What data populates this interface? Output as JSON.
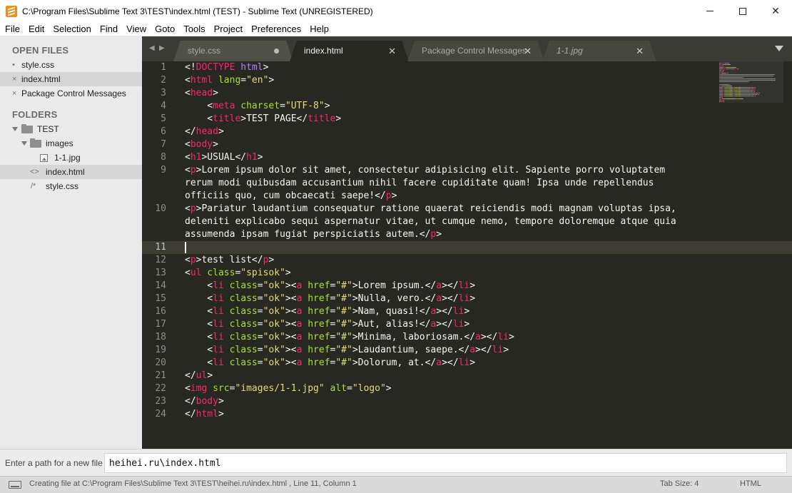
{
  "window": {
    "title": "C:\\Program Files\\Sublime Text 3\\TEST\\index.html (TEST) - Sublime Text (UNREGISTERED)"
  },
  "menu": [
    "File",
    "Edit",
    "Selection",
    "Find",
    "View",
    "Goto",
    "Tools",
    "Project",
    "Preferences",
    "Help"
  ],
  "sidebar": {
    "open_files_heading": "OPEN FILES",
    "open_files": [
      {
        "label": "style.css",
        "mark": "•"
      },
      {
        "label": "index.html",
        "mark": "×"
      },
      {
        "label": "Package Control Messages",
        "mark": "×"
      }
    ],
    "folders_heading": "FOLDERS",
    "tree": [
      {
        "label": "TEST",
        "icon": "folder-open-icon"
      },
      {
        "label": "images",
        "icon": "folder-open-icon"
      },
      {
        "label": "1-1.jpg",
        "icon": "image-file-icon"
      },
      {
        "label": "index.html",
        "icon": "html-file-icon",
        "mark": "<>"
      },
      {
        "label": "style.css",
        "icon": "css-file-icon",
        "mark": "/*"
      }
    ]
  },
  "tabs": [
    {
      "label": "style.css",
      "state": "modified"
    },
    {
      "label": "index.html",
      "state": "active"
    },
    {
      "label": "Package Control Messages",
      "state": "closable"
    },
    {
      "label": "1-1.jpg",
      "state": "preview"
    }
  ],
  "editor": {
    "current_line": 11,
    "lines": [
      {
        "n": "1",
        "segs": [
          [
            "p",
            "<!"
          ],
          [
            "t",
            "DOCTYPE"
          ],
          [
            "p",
            " "
          ],
          [
            "k",
            "html"
          ],
          [
            "p",
            ">"
          ]
        ]
      },
      {
        "n": "2",
        "segs": [
          [
            "p",
            "<"
          ],
          [
            "t",
            "html"
          ],
          [
            "p",
            " "
          ],
          [
            "a",
            "lang"
          ],
          [
            "p",
            "="
          ],
          [
            "s",
            "\"en\""
          ],
          [
            "p",
            ">"
          ]
        ]
      },
      {
        "n": "3",
        "segs": [
          [
            "p",
            "<"
          ],
          [
            "t",
            "head"
          ],
          [
            "p",
            ">"
          ]
        ]
      },
      {
        "n": "4",
        "segs": [
          [
            "p",
            "    <"
          ],
          [
            "t",
            "meta"
          ],
          [
            "p",
            " "
          ],
          [
            "a",
            "charset"
          ],
          [
            "p",
            "="
          ],
          [
            "s",
            "\"UTF-8\""
          ],
          [
            "p",
            ">"
          ]
        ]
      },
      {
        "n": "5",
        "segs": [
          [
            "p",
            "    <"
          ],
          [
            "t",
            "title"
          ],
          [
            "p",
            ">TEST PAGE</"
          ],
          [
            "t",
            "title"
          ],
          [
            "p",
            ">"
          ]
        ]
      },
      {
        "n": "6",
        "segs": [
          [
            "p",
            "</"
          ],
          [
            "t",
            "head"
          ],
          [
            "p",
            ">"
          ]
        ]
      },
      {
        "n": "7",
        "segs": [
          [
            "p",
            "<"
          ],
          [
            "t",
            "body"
          ],
          [
            "p",
            ">"
          ]
        ]
      },
      {
        "n": "8",
        "segs": [
          [
            "p",
            "<"
          ],
          [
            "t",
            "h1"
          ],
          [
            "p",
            ">USUAL</"
          ],
          [
            "t",
            "h1"
          ],
          [
            "p",
            ">"
          ]
        ]
      },
      {
        "n": "9",
        "segs": [
          [
            "p",
            "<"
          ],
          [
            "t",
            "p"
          ],
          [
            "p",
            ">Lorem ipsum dolor sit amet, consectetur adipisicing elit. Sapiente porro voluptatem"
          ]
        ]
      },
      {
        "n": "",
        "segs": [
          [
            "p",
            "rerum modi quibusdam accusantium nihil facere cupiditate quam! Ipsa unde repellendus"
          ]
        ]
      },
      {
        "n": "",
        "segs": [
          [
            "p",
            "officiis quo, cum obcaecati saepe!</"
          ],
          [
            "t",
            "p"
          ],
          [
            "p",
            ">"
          ]
        ]
      },
      {
        "n": "10",
        "segs": [
          [
            "p",
            "<"
          ],
          [
            "t",
            "p"
          ],
          [
            "p",
            ">Pariatur laudantium consequatur ratione quaerat reiciendis modi magnam voluptas ipsa,"
          ]
        ]
      },
      {
        "n": "",
        "segs": [
          [
            "p",
            "deleniti explicabo sequi aspernatur vitae, ut cumque nemo, tempore doloremque atque quia"
          ]
        ]
      },
      {
        "n": "",
        "segs": [
          [
            "p",
            "assumenda ipsam fugiat perspiciatis autem.</"
          ],
          [
            "t",
            "p"
          ],
          [
            "p",
            ">"
          ]
        ]
      },
      {
        "n": "11",
        "segs": []
      },
      {
        "n": "12",
        "segs": [
          [
            "p",
            "<"
          ],
          [
            "t",
            "p"
          ],
          [
            "p",
            ">test list</"
          ],
          [
            "t",
            "p"
          ],
          [
            "p",
            ">"
          ]
        ]
      },
      {
        "n": "13",
        "segs": [
          [
            "p",
            "<"
          ],
          [
            "t",
            "ul"
          ],
          [
            "p",
            " "
          ],
          [
            "a",
            "class"
          ],
          [
            "p",
            "="
          ],
          [
            "s",
            "\"spisok\""
          ],
          [
            "p",
            ">"
          ]
        ]
      },
      {
        "n": "14",
        "segs": [
          [
            "p",
            "    <"
          ],
          [
            "t",
            "li"
          ],
          [
            "p",
            " "
          ],
          [
            "a",
            "class"
          ],
          [
            "p",
            "="
          ],
          [
            "s",
            "\"ok\""
          ],
          [
            "p",
            "><"
          ],
          [
            "t",
            "a"
          ],
          [
            "p",
            " "
          ],
          [
            "a",
            "href"
          ],
          [
            "p",
            "="
          ],
          [
            "s",
            "\"#\""
          ],
          [
            "p",
            ">Lorem ipsum.</"
          ],
          [
            "t",
            "a"
          ],
          [
            "p",
            "></"
          ],
          [
            "t",
            "li"
          ],
          [
            "p",
            ">"
          ]
        ]
      },
      {
        "n": "15",
        "segs": [
          [
            "p",
            "    <"
          ],
          [
            "t",
            "li"
          ],
          [
            "p",
            " "
          ],
          [
            "a",
            "class"
          ],
          [
            "p",
            "="
          ],
          [
            "s",
            "\"ok\""
          ],
          [
            "p",
            "><"
          ],
          [
            "t",
            "a"
          ],
          [
            "p",
            " "
          ],
          [
            "a",
            "href"
          ],
          [
            "p",
            "="
          ],
          [
            "s",
            "\"#\""
          ],
          [
            "p",
            ">Nulla, vero.</"
          ],
          [
            "t",
            "a"
          ],
          [
            "p",
            "></"
          ],
          [
            "t",
            "li"
          ],
          [
            "p",
            ">"
          ]
        ]
      },
      {
        "n": "16",
        "segs": [
          [
            "p",
            "    <"
          ],
          [
            "t",
            "li"
          ],
          [
            "p",
            " "
          ],
          [
            "a",
            "class"
          ],
          [
            "p",
            "="
          ],
          [
            "s",
            "\"ok\""
          ],
          [
            "p",
            "><"
          ],
          [
            "t",
            "a"
          ],
          [
            "p",
            " "
          ],
          [
            "a",
            "href"
          ],
          [
            "p",
            "="
          ],
          [
            "s",
            "\"#\""
          ],
          [
            "p",
            ">Nam, quasi!</"
          ],
          [
            "t",
            "a"
          ],
          [
            "p",
            "></"
          ],
          [
            "t",
            "li"
          ],
          [
            "p",
            ">"
          ]
        ]
      },
      {
        "n": "17",
        "segs": [
          [
            "p",
            "    <"
          ],
          [
            "t",
            "li"
          ],
          [
            "p",
            " "
          ],
          [
            "a",
            "class"
          ],
          [
            "p",
            "="
          ],
          [
            "s",
            "\"ok\""
          ],
          [
            "p",
            "><"
          ],
          [
            "t",
            "a"
          ],
          [
            "p",
            " "
          ],
          [
            "a",
            "href"
          ],
          [
            "p",
            "="
          ],
          [
            "s",
            "\"#\""
          ],
          [
            "p",
            ">Aut, alias!</"
          ],
          [
            "t",
            "a"
          ],
          [
            "p",
            "></"
          ],
          [
            "t",
            "li"
          ],
          [
            "p",
            ">"
          ]
        ]
      },
      {
        "n": "18",
        "segs": [
          [
            "p",
            "    <"
          ],
          [
            "t",
            "li"
          ],
          [
            "p",
            " "
          ],
          [
            "a",
            "class"
          ],
          [
            "p",
            "="
          ],
          [
            "s",
            "\"ok\""
          ],
          [
            "p",
            "><"
          ],
          [
            "t",
            "a"
          ],
          [
            "p",
            " "
          ],
          [
            "a",
            "href"
          ],
          [
            "p",
            "="
          ],
          [
            "s",
            "\"#\""
          ],
          [
            "p",
            ">Minima, laboriosam.</"
          ],
          [
            "t",
            "a"
          ],
          [
            "p",
            "></"
          ],
          [
            "t",
            "li"
          ],
          [
            "p",
            ">"
          ]
        ]
      },
      {
        "n": "19",
        "segs": [
          [
            "p",
            "    <"
          ],
          [
            "t",
            "li"
          ],
          [
            "p",
            " "
          ],
          [
            "a",
            "class"
          ],
          [
            "p",
            "="
          ],
          [
            "s",
            "\"ok\""
          ],
          [
            "p",
            "><"
          ],
          [
            "t",
            "a"
          ],
          [
            "p",
            " "
          ],
          [
            "a",
            "href"
          ],
          [
            "p",
            "="
          ],
          [
            "s",
            "\"#\""
          ],
          [
            "p",
            ">Laudantium, saepe.</"
          ],
          [
            "t",
            "a"
          ],
          [
            "p",
            "></"
          ],
          [
            "t",
            "li"
          ],
          [
            "p",
            ">"
          ]
        ]
      },
      {
        "n": "20",
        "segs": [
          [
            "p",
            "    <"
          ],
          [
            "t",
            "li"
          ],
          [
            "p",
            " "
          ],
          [
            "a",
            "class"
          ],
          [
            "p",
            "="
          ],
          [
            "s",
            "\"ok\""
          ],
          [
            "p",
            "><"
          ],
          [
            "t",
            "a"
          ],
          [
            "p",
            " "
          ],
          [
            "a",
            "href"
          ],
          [
            "p",
            "="
          ],
          [
            "s",
            "\"#\""
          ],
          [
            "p",
            ">Dolorum, at.</"
          ],
          [
            "t",
            "a"
          ],
          [
            "p",
            "></"
          ],
          [
            "t",
            "li"
          ],
          [
            "p",
            ">"
          ]
        ]
      },
      {
        "n": "21",
        "segs": [
          [
            "p",
            "</"
          ],
          [
            "t",
            "ul"
          ],
          [
            "p",
            ">"
          ]
        ]
      },
      {
        "n": "22",
        "segs": [
          [
            "p",
            "<"
          ],
          [
            "t",
            "img"
          ],
          [
            "p",
            " "
          ],
          [
            "a",
            "src"
          ],
          [
            "p",
            "="
          ],
          [
            "s",
            "\"images/1-1.jpg\""
          ],
          [
            "p",
            " "
          ],
          [
            "a",
            "alt"
          ],
          [
            "p",
            "="
          ],
          [
            "s",
            "\"logo\""
          ],
          [
            "p",
            ">"
          ]
        ]
      },
      {
        "n": "23",
        "segs": [
          [
            "p",
            "</"
          ],
          [
            "t",
            "body"
          ],
          [
            "p",
            ">"
          ]
        ]
      },
      {
        "n": "24",
        "segs": [
          [
            "p",
            "</"
          ],
          [
            "t",
            "html"
          ],
          [
            "p",
            ">"
          ]
        ]
      }
    ]
  },
  "panel": {
    "label": "Enter a path for a new file",
    "value": "heihei.ru\\index.html"
  },
  "status": {
    "message": "Creating file at C:\\Program Files\\Sublime Text 3\\TEST\\heihei.ru\\index.html , Line 11, Column 1",
    "tab_size": "Tab Size: 4",
    "syntax": "HTML"
  },
  "colors": {
    "editor_bg": "#272822",
    "tag": "#f92672",
    "attribute": "#a6e22e",
    "string": "#e6db74",
    "keyword": "#ae81ff",
    "text": "#f8f8f2",
    "sidebar_bg": "#eaeaea"
  }
}
